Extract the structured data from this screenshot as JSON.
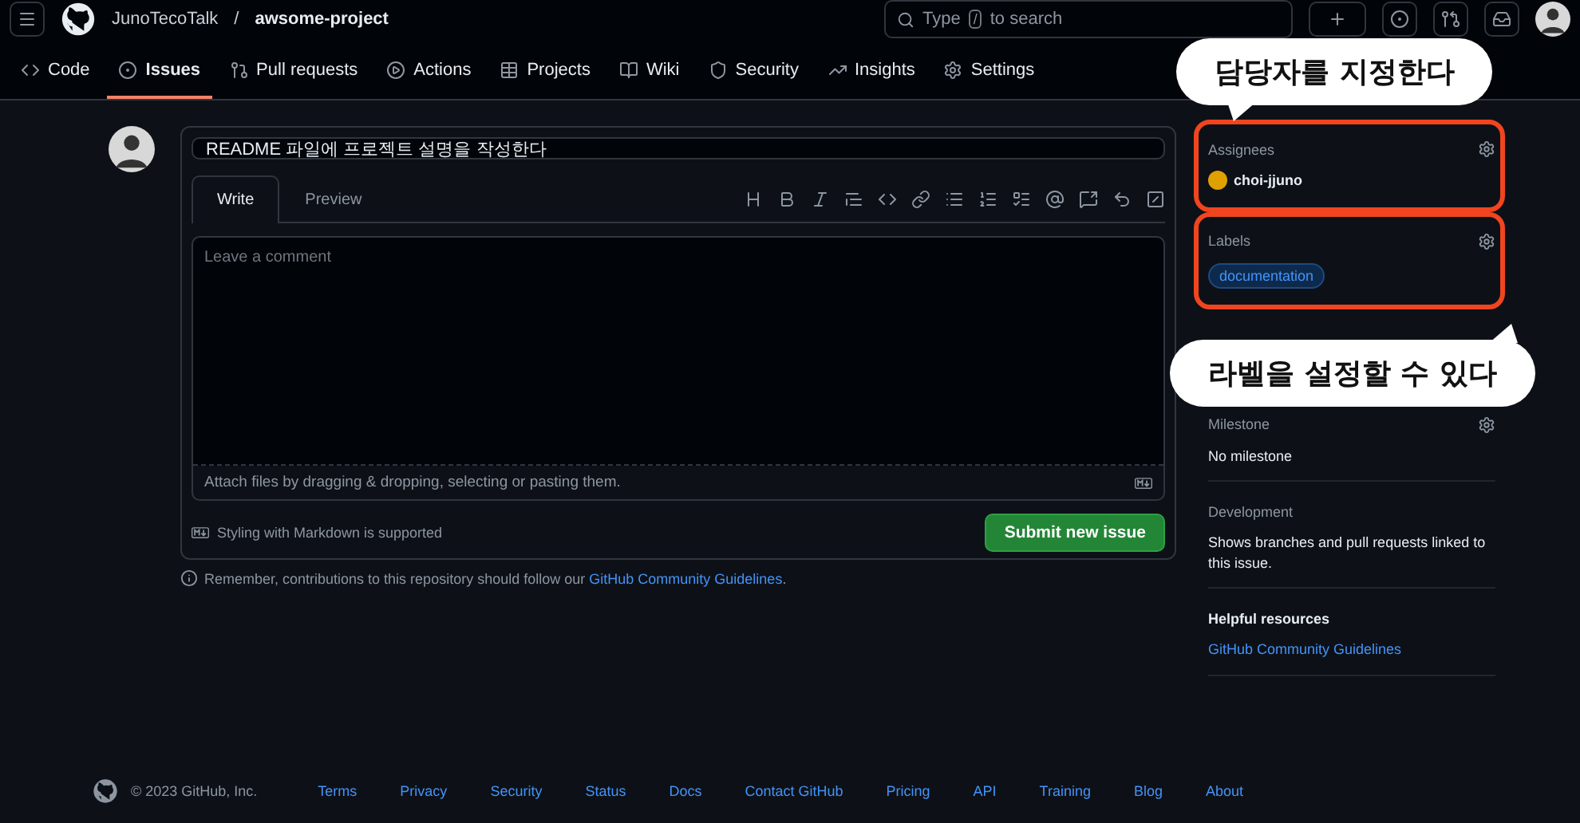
{
  "header": {
    "owner": "JunoTecoTalk",
    "separator": "/",
    "repo": "awsome-project",
    "search_prefix": "Type",
    "search_key": "/",
    "search_suffix": "to search"
  },
  "nav": [
    {
      "label": "Code",
      "selected": false
    },
    {
      "label": "Issues",
      "selected": true
    },
    {
      "label": "Pull requests",
      "selected": false
    },
    {
      "label": "Actions",
      "selected": false
    },
    {
      "label": "Projects",
      "selected": false
    },
    {
      "label": "Wiki",
      "selected": false
    },
    {
      "label": "Security",
      "selected": false
    },
    {
      "label": "Insights",
      "selected": false
    },
    {
      "label": "Settings",
      "selected": false
    }
  ],
  "issue": {
    "title": "README 파일에 프로젝트 설명을 작성한다",
    "tabs": [
      {
        "label": "Write",
        "selected": true
      },
      {
        "label": "Preview",
        "selected": false
      }
    ],
    "comment_placeholder": "Leave a comment",
    "attach_hint": "Attach files by dragging & dropping, selecting or pasting them.",
    "markdown_note": "Styling with Markdown is supported",
    "submit": "Submit new issue",
    "reminder": "Remember, contributions to this repository should follow our",
    "reminder_link": "GitHub Community Guidelines",
    "reminder_end": "."
  },
  "sidebar": {
    "assignees": {
      "heading": "Assignees",
      "user": "choi-jjuno",
      "highlighted": true
    },
    "labels": {
      "heading": "Labels",
      "label": "documentation",
      "highlighted": true
    },
    "milestone": {
      "heading": "Milestone",
      "value": "No milestone"
    },
    "development": {
      "heading": "Development",
      "text": "Shows branches and pull requests linked to this issue."
    },
    "resources": {
      "heading": "Helpful resources",
      "link": "GitHub Community Guidelines"
    }
  },
  "callouts": [
    {
      "text": "담당자를 지정한다"
    },
    {
      "text": "라벨을 설정할 수 있다"
    }
  ],
  "footer": {
    "copyright": "© 2023 GitHub, Inc.",
    "links": [
      "Terms",
      "Privacy",
      "Security",
      "Status",
      "Docs",
      "Contact GitHub",
      "Pricing",
      "API",
      "Training",
      "Blog",
      "About"
    ]
  }
}
